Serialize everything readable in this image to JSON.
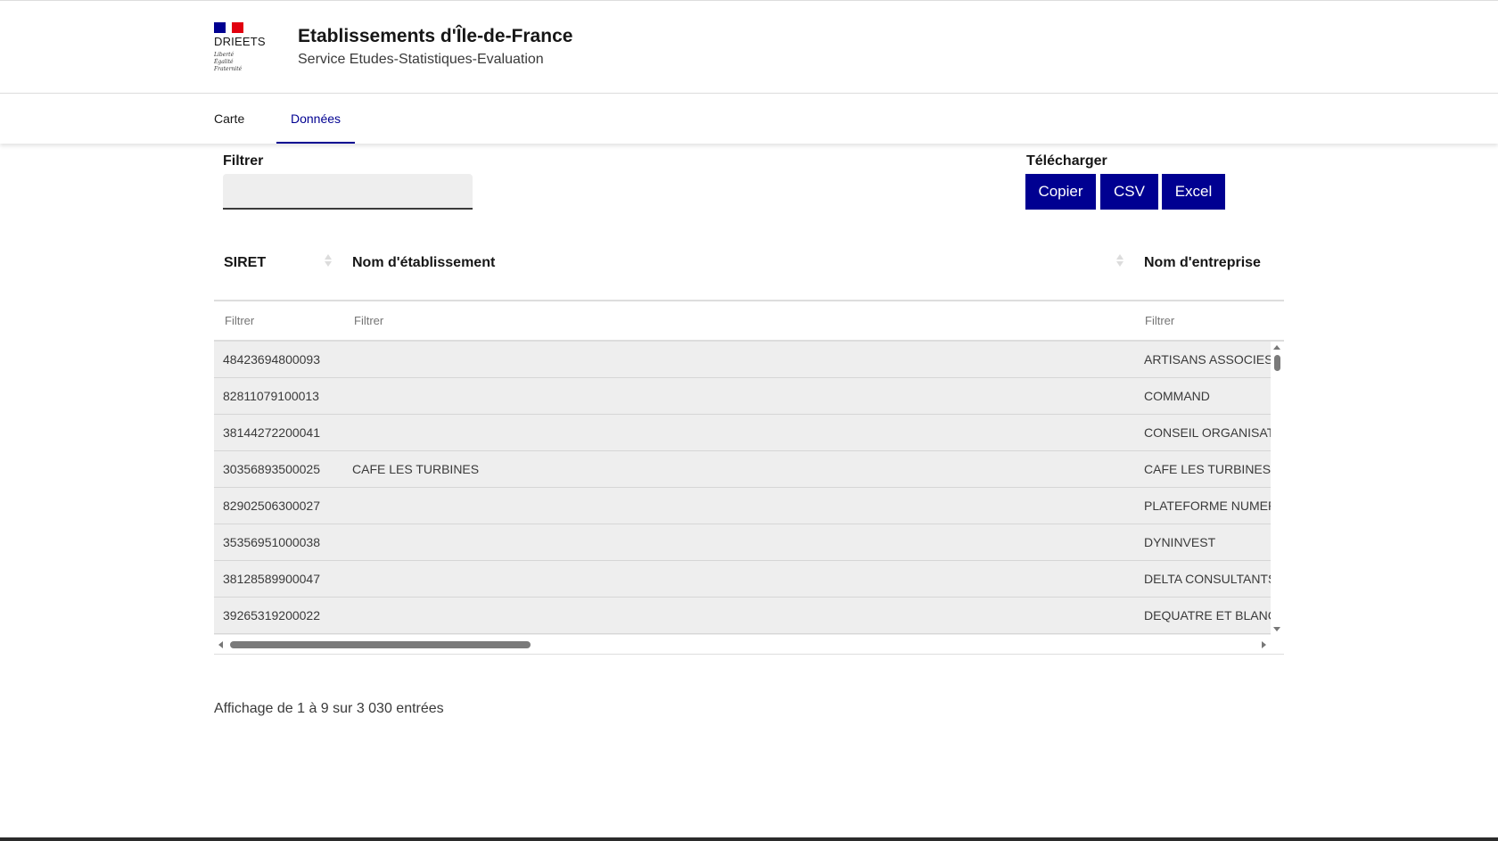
{
  "header": {
    "logo_text": "DRIEETS",
    "logo_motto": [
      "Liberté",
      "Égalité",
      "Fraternité"
    ],
    "title": "Etablissements d'Île-de-France",
    "subtitle": "Service Etudes-Statistiques-Evaluation"
  },
  "nav": {
    "tabs": [
      {
        "label": "Carte",
        "active": false
      },
      {
        "label": "Données",
        "active": true
      }
    ]
  },
  "filter": {
    "label": "Filtrer",
    "value": ""
  },
  "download": {
    "label": "Télécharger",
    "buttons": [
      "Copier",
      "CSV",
      "Excel"
    ]
  },
  "table": {
    "columns": [
      "SIRET",
      "Nom d'établissement",
      "Nom d'entreprise"
    ],
    "filter_placeholder": "Filtrer",
    "rows": [
      [
        "48423694800093",
        "",
        "ARTISANS ASSOCIES"
      ],
      [
        "82811079100013",
        "",
        "COMMAND"
      ],
      [
        "38144272200041",
        "",
        "CONSEIL ORGANISAT"
      ],
      [
        "30356893500025",
        "CAFE LES TURBINES",
        "CAFE LES TURBINES"
      ],
      [
        "82902506300027",
        "",
        "PLATEFORME NUMER"
      ],
      [
        "35356951000038",
        "",
        "DYNINVEST"
      ],
      [
        "38128589900047",
        "",
        "DELTA CONSULTANTS"
      ],
      [
        "39265319200022",
        "",
        "DEQUATRE ET BLANC"
      ]
    ]
  },
  "info": "Affichage de 1 à 9 sur 3 030 entrées",
  "colors": {
    "primary": "#000091",
    "row_bg": "#eeeeee",
    "flag_red": "#e1000f"
  }
}
